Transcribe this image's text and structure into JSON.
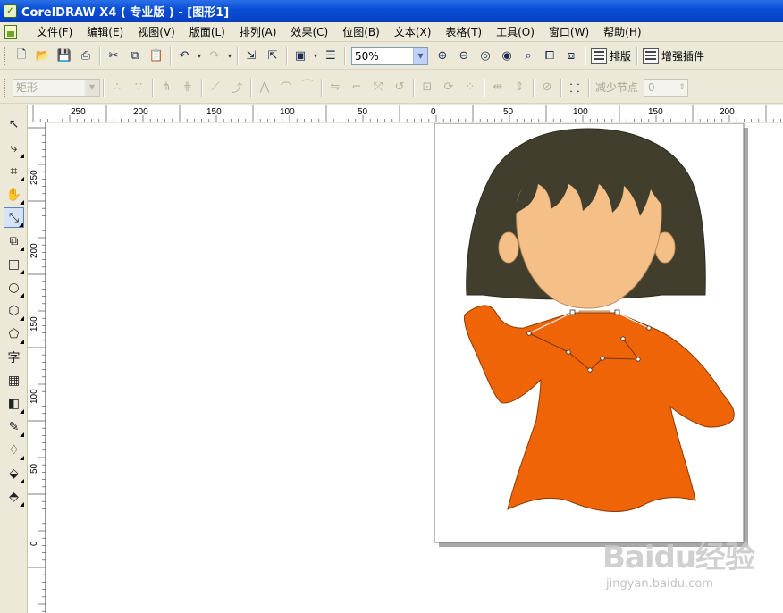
{
  "window": {
    "title": "CorelDRAW X4 ( 专业版 ) - [图形1]"
  },
  "menu": [
    "文件(F)",
    "编辑(E)",
    "视图(V)",
    "版面(L)",
    "排列(A)",
    "效果(C)",
    "位图(B)",
    "文本(X)",
    "表格(T)",
    "工具(O)",
    "窗口(W)",
    "帮助(H)"
  ],
  "toolbar": {
    "zoom": "50%",
    "layout_label": "排版",
    "plugin_label": "增强插件"
  },
  "property_bar": {
    "shape_type": "矩形",
    "reduce_nodes_label": "减少节点",
    "reduce_nodes_value": "0"
  },
  "ruler_h_labels": [
    "250",
    "200",
    "150",
    "100",
    "50",
    "0",
    "50",
    "100",
    "150",
    "200"
  ],
  "ruler_v_labels": [
    "250",
    "200",
    "150",
    "100",
    "50",
    "0"
  ],
  "colors": {
    "hair": "#413e2d",
    "face": "#f4c088",
    "shirt": "#ef6407",
    "title_bar": "#0a4fd6",
    "canvas": "#ffffff",
    "page_shadow": "#a8a8a8"
  },
  "tools": [
    "pick-tool",
    "shape-tool",
    "crop-tool",
    "pan-tool",
    "bezier-tool",
    "smart-fill-tool",
    "rectangle-tool",
    "ellipse-tool",
    "polygon-tool",
    "basic-shapes-tool",
    "text-tool",
    "table-tool",
    "blend-tool",
    "eyedropper-tool",
    "outline-tool",
    "fill-tool",
    "interactive-fill-tool"
  ],
  "watermark": {
    "logo": "Baidu经验",
    "url": "jingyan.baidu.com"
  }
}
